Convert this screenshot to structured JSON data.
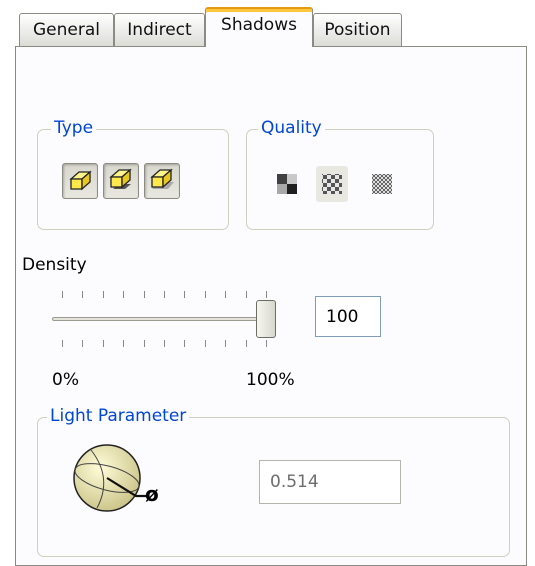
{
  "tabs": [
    {
      "label": "General"
    },
    {
      "label": "Indirect"
    },
    {
      "label": "Shadows"
    },
    {
      "label": "Position"
    }
  ],
  "type_group": {
    "label": "Type"
  },
  "quality_group": {
    "label": "Quality"
  },
  "density": {
    "label": "Density",
    "value": "100",
    "min_label": "0%",
    "max_label": "100%",
    "slider_fraction": 1.0
  },
  "light_parameter": {
    "label": "Light Parameter",
    "value": "0.514",
    "phi_symbol": "ø"
  },
  "colors": {
    "group_label": "#0046d5",
    "active_tab_highlight": "#ffc83c"
  }
}
